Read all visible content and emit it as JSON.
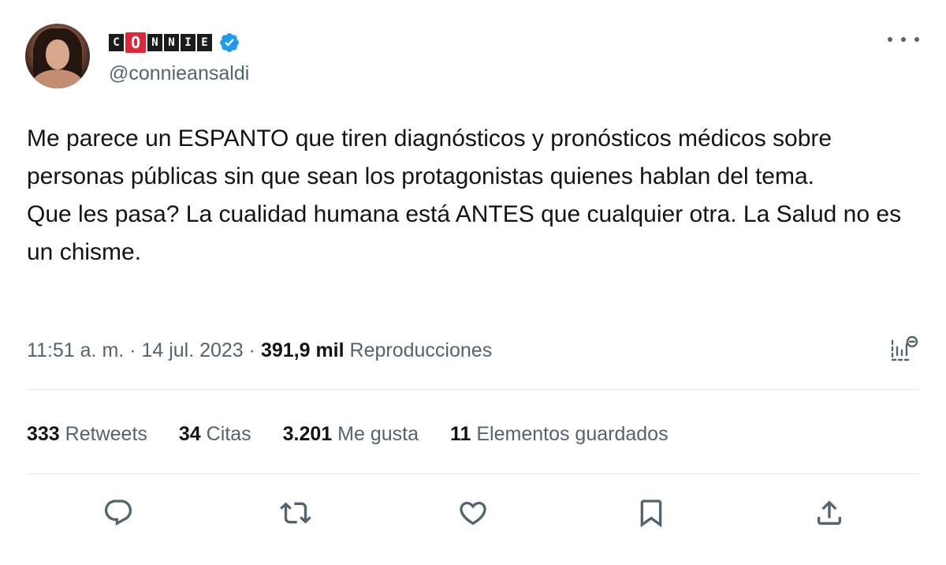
{
  "user": {
    "name_letters": [
      "C",
      "O",
      "N",
      "N",
      "I",
      "E"
    ],
    "handle": "@connieansaldi",
    "avatar_icon": "profile-photo"
  },
  "tweet": {
    "line1": "Me parece un ESPANTO que tiren diagnósticos y pronósticos médicos sobre personas públicas sin que sean los protagonistas quienes hablan del tema.",
    "line2": "Que les pasa? La cualidad humana está ANTES que cualquier otra. La Salud no es un chisme."
  },
  "meta": {
    "time": "11:51 a. m.",
    "separator": " · ",
    "date": "14 jul. 2023",
    "views_count": "391,9 mil",
    "views_label": "Reproducciones"
  },
  "stats": {
    "retweets_count": "333",
    "retweets_label": "Retweets",
    "quotes_count": "34",
    "quotes_label": "Citas",
    "likes_count": "3.201",
    "likes_label": "Me gusta",
    "bookmarks_count": "11",
    "bookmarks_label": "Elementos guardados"
  },
  "actions": [
    "reply-icon",
    "retweet-icon",
    "like-icon",
    "bookmark-icon",
    "share-icon"
  ],
  "colors": {
    "text": "#0f1419",
    "secondary": "#536471",
    "verified": "#1d9bf0",
    "logo_accent": "#e0263a",
    "divider": "#e4e8eb"
  }
}
